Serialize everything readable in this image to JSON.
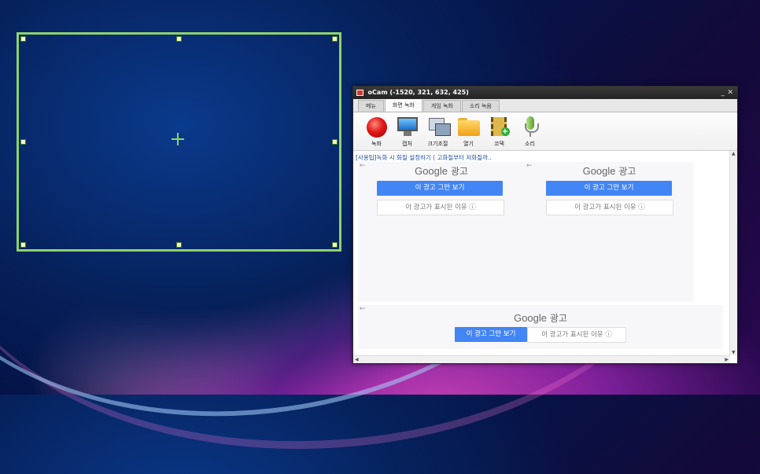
{
  "window": {
    "title": "oCam (-1520, 321, 632, 425)",
    "minimize_label": "_",
    "close_label": "✕"
  },
  "tabs": [
    {
      "label": "메뉴"
    },
    {
      "label": "화면 녹화"
    },
    {
      "label": "게임 녹화"
    },
    {
      "label": "소리 녹음"
    }
  ],
  "toolbar": [
    {
      "label": "녹화",
      "icon": "record-icon"
    },
    {
      "label": "캡처",
      "icon": "monitor-icon"
    },
    {
      "label": "크기조절",
      "icon": "resize-icon"
    },
    {
      "label": "열기",
      "icon": "folder-icon"
    },
    {
      "label": "코덱",
      "icon": "film-add-icon"
    },
    {
      "label": "소리",
      "icon": "microphone-icon"
    }
  ],
  "tip_text": "[사용팁]녹화 시 화질 설정하기 ( 고화질부터 저화질까..",
  "ads": [
    {
      "arrow": "←",
      "brand": "Google",
      "label": "광고",
      "stop": "이 광고 그만 보기",
      "why": "이 광고가 표시된 이유 ⓘ"
    },
    {
      "arrow": "←",
      "brand": "Google",
      "label": "광고",
      "stop": "이 광고 그만 보기",
      "why": "이 광고가 표시된 이유 ⓘ"
    },
    {
      "arrow": "←",
      "brand": "Google",
      "label": "광고",
      "stop": "이 광고 그만 보기",
      "why": "이 광고가 표시된 이유 ⓘ"
    }
  ],
  "colors": {
    "region_border": "#8ed36b",
    "ad_button": "#4285f4",
    "record_red": "#e01818"
  }
}
